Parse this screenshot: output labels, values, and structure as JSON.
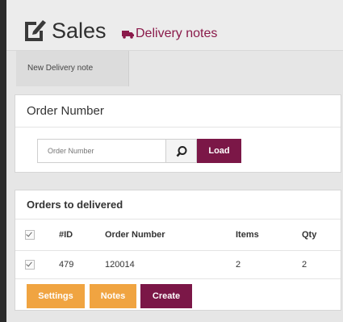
{
  "header": {
    "title": "Sales",
    "subtitle": "Delivery notes"
  },
  "tabs": [
    {
      "label": "New Delivery note"
    }
  ],
  "order_panel": {
    "title": "Order Number",
    "input_placeholder": "Order Number",
    "input_value": "",
    "load_label": "Load"
  },
  "orders_panel": {
    "title": "Orders to delivered",
    "columns": [
      "#ID",
      "Order Number",
      "Items",
      "Qty"
    ],
    "rows": [
      {
        "id": "479",
        "order_number": "120014",
        "items": "2",
        "qty": "2",
        "checked": true
      }
    ],
    "header_checked": true
  },
  "actions": {
    "settings": "Settings",
    "notes": "Notes",
    "create": "Create"
  },
  "colors": {
    "accent": "#7b1747",
    "warning": "#f0a441",
    "subtitle": "#8a1a4a"
  },
  "icons": {
    "title": "edit-square-icon",
    "subtitle": "truck-icon",
    "search": "search-icon"
  }
}
